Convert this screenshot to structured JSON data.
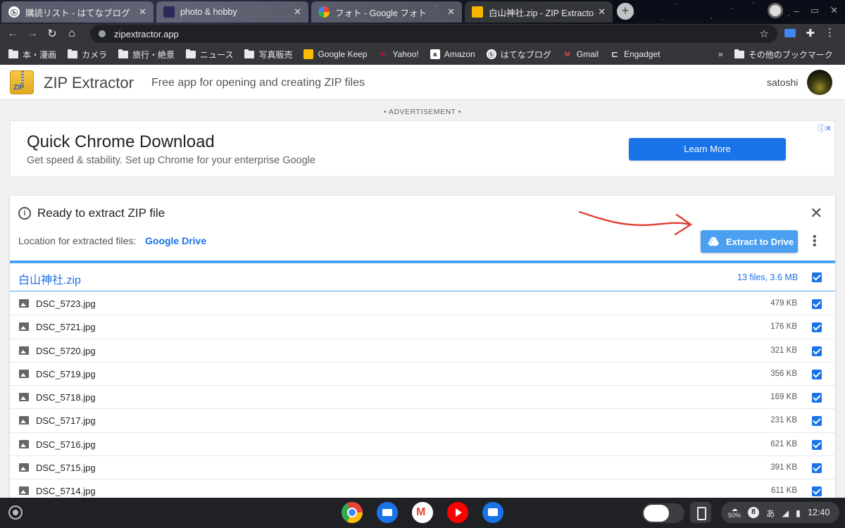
{
  "browser": {
    "tabs": [
      {
        "title": "購読リスト - はてなブログ",
        "active": false
      },
      {
        "title": "photo & hobby",
        "active": false
      },
      {
        "title": "フォト - Google フォト",
        "active": false
      },
      {
        "title": "白山神社.zip - ZIP Extractor",
        "active": true
      }
    ],
    "url": "zipextractor.app",
    "bookmarks": [
      {
        "label": "本・漫画",
        "icon": "folder-icon"
      },
      {
        "label": "カメラ",
        "icon": "folder-icon"
      },
      {
        "label": "旅行・絶景",
        "icon": "folder-icon"
      },
      {
        "label": "ニュース",
        "icon": "folder-icon"
      },
      {
        "label": "写真販売",
        "icon": "folder-icon"
      },
      {
        "label": "Google Keep",
        "icon": "keep-icon"
      },
      {
        "label": "Yahoo!",
        "icon": "yahoo-icon"
      },
      {
        "label": "Amazon",
        "icon": "amazon-icon"
      },
      {
        "label": "はてなブログ",
        "icon": "hatena-icon"
      },
      {
        "label": "Gmail",
        "icon": "gmail-icon"
      },
      {
        "label": "Engadget",
        "icon": "engadget-icon"
      }
    ],
    "bookmarks_more": "»",
    "other_bookmarks": "その他のブックマーク"
  },
  "app": {
    "logo_text": "ZIP",
    "title": "ZIP Extractor",
    "subtitle": "Free app for opening and creating ZIP files",
    "user": "satoshi"
  },
  "ad": {
    "label": "• ADVERTISEMENT •",
    "title": "Quick Chrome Download",
    "text": "Get speed & stability. Set up Chrome for your enterprise Google",
    "button": "Learn More",
    "info": "ⓘ✕"
  },
  "extractor": {
    "status": "Ready to extract ZIP file",
    "location_label": "Location for extracted files:",
    "location_value": "Google Drive",
    "extract_button": "Extract to Drive",
    "zip_name": "白山神社.zip",
    "zip_info": "13 files, 3.6 MB",
    "files": [
      {
        "name": "DSC_5723.jpg",
        "size": "479 KB",
        "checked": true
      },
      {
        "name": "DSC_5721.jpg",
        "size": "176 KB",
        "checked": true
      },
      {
        "name": "DSC_5720.jpg",
        "size": "321 KB",
        "checked": true
      },
      {
        "name": "DSC_5719.jpg",
        "size": "356 KB",
        "checked": true
      },
      {
        "name": "DSC_5718.jpg",
        "size": "169 KB",
        "checked": true
      },
      {
        "name": "DSC_5717.jpg",
        "size": "231 KB",
        "checked": true
      },
      {
        "name": "DSC_5716.jpg",
        "size": "621 KB",
        "checked": true
      },
      {
        "name": "DSC_5715.jpg",
        "size": "391 KB",
        "checked": true
      },
      {
        "name": "DSC_5714.jpg",
        "size": "611 KB",
        "checked": true
      }
    ]
  },
  "shelf": {
    "apps": [
      "chrome-icon",
      "files-icon",
      "gmail-icon",
      "youtube-icon",
      "messages-icon"
    ],
    "notification_count": "8",
    "battery": "50%",
    "ime": "あ",
    "time": "12:40"
  },
  "colors": {
    "accent": "#1a73e8",
    "extract_button": "#4a9ff0",
    "annotation_arrow": "#e0443a"
  }
}
